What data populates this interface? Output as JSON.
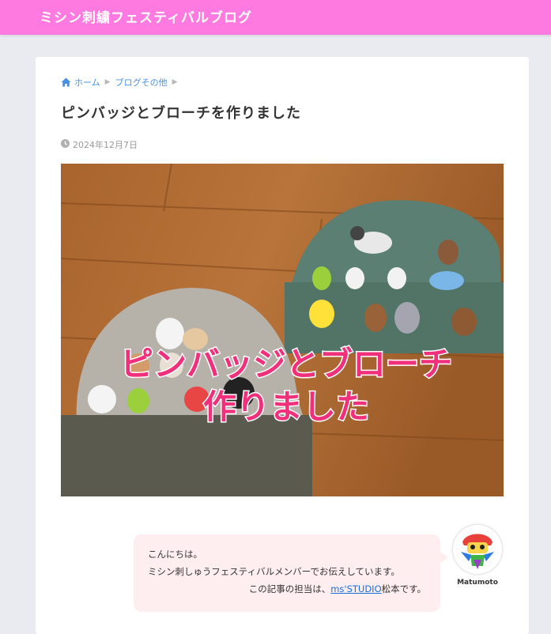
{
  "header": {
    "site_title": "ミシン刺繍フェスティバルブログ",
    "bar_color": "#ff7ae0"
  },
  "breadcrumb": {
    "icon": "home-icon",
    "items": [
      "ホーム",
      "ブログその他"
    ]
  },
  "post": {
    "title": "ピンバッジとブローチを作りました",
    "date_icon": "clock-icon",
    "date": "2024年12月7日"
  },
  "hero_image": {
    "overlay_line1": "ピンバッジとブローチ",
    "overlay_line2": "作りました",
    "overlay_color": "#f0307a"
  },
  "author_box": {
    "greeting": "こんにちは。",
    "line2": "ミシン刺しゅうフェスティバルメンバーでお伝えしています。",
    "line3_prefix": "この記事の担当は、",
    "line3_link": "ms'STUDIO",
    "line3_suffix": "松本です。",
    "author_name": "Matumoto",
    "balloon_color": "#ffeef0"
  }
}
